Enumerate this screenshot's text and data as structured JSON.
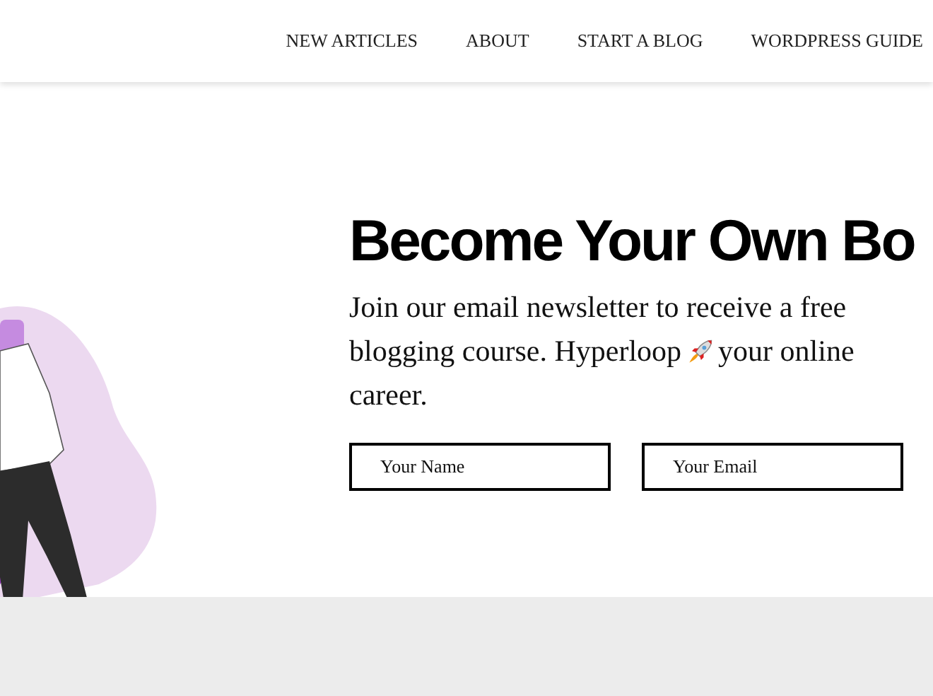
{
  "nav": {
    "items": [
      "NEW ARTICLES",
      "ABOUT",
      "START A BLOG",
      "WORDPRESS GUIDE"
    ]
  },
  "hero": {
    "title": "Become Your Own Bo",
    "description_lines": [
      "Join our email newsletter to receive a free",
      "blogging course. Hyperloop",
      "your online",
      "career."
    ],
    "fields": [
      {
        "placeholder": "Your Name"
      },
      {
        "placeholder": "Your Email"
      }
    ]
  }
}
